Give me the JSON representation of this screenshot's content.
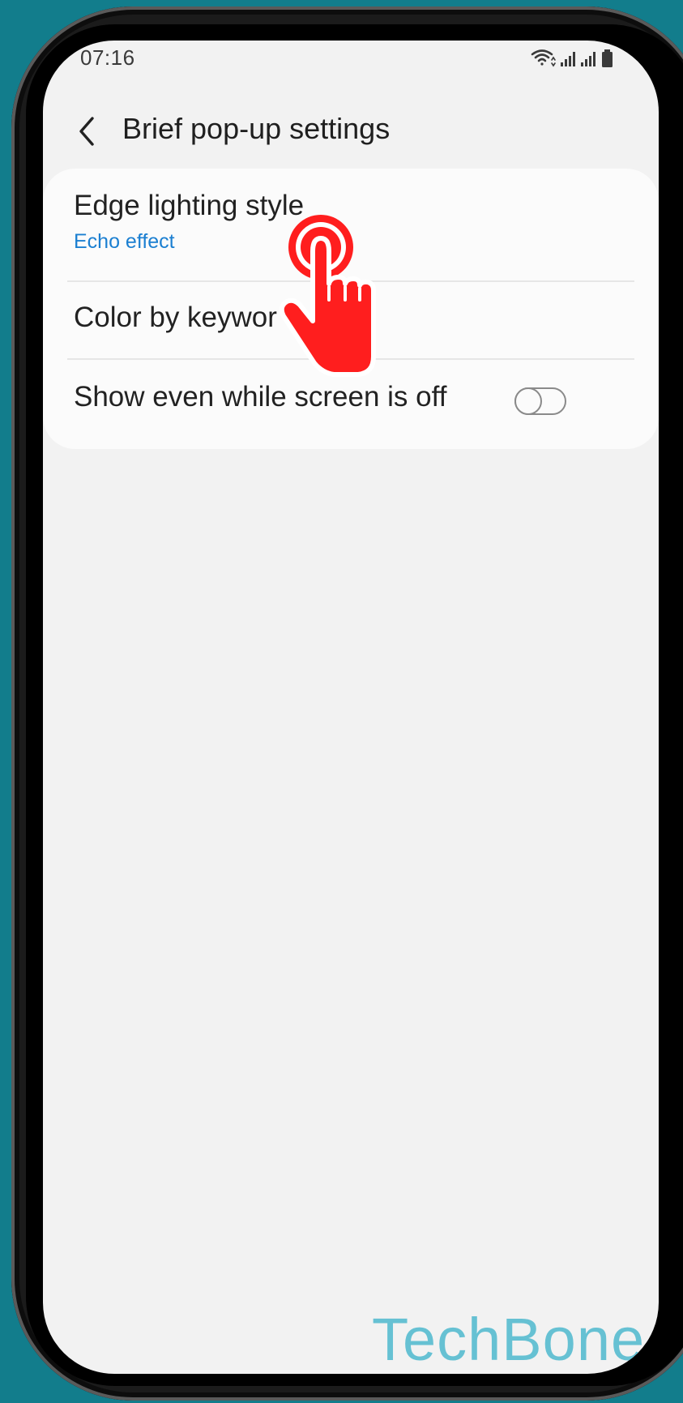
{
  "status_bar": {
    "time": "07:16"
  },
  "header": {
    "title": "Brief pop-up settings"
  },
  "settings": {
    "items": [
      {
        "title": "Edge lighting style",
        "subtitle": "Echo effect"
      },
      {
        "title": "Color by keywor"
      },
      {
        "title": "Show even while screen is off",
        "toggle": "off"
      }
    ]
  },
  "watermark": {
    "text": "TechBone"
  },
  "colors": {
    "background": "#127d8c",
    "screen": "#f2f2f2",
    "card": "#fbfbfb",
    "accent": "#1b7fd1",
    "tap_indicator": "#ff1e1e",
    "watermark": "#66c1d3"
  },
  "icons": {
    "back": "chevron-left-icon",
    "wifi": "wifi-icon",
    "signal": "signal-bars-icon",
    "battery": "battery-icon",
    "tap": "tap-hand-icon"
  }
}
